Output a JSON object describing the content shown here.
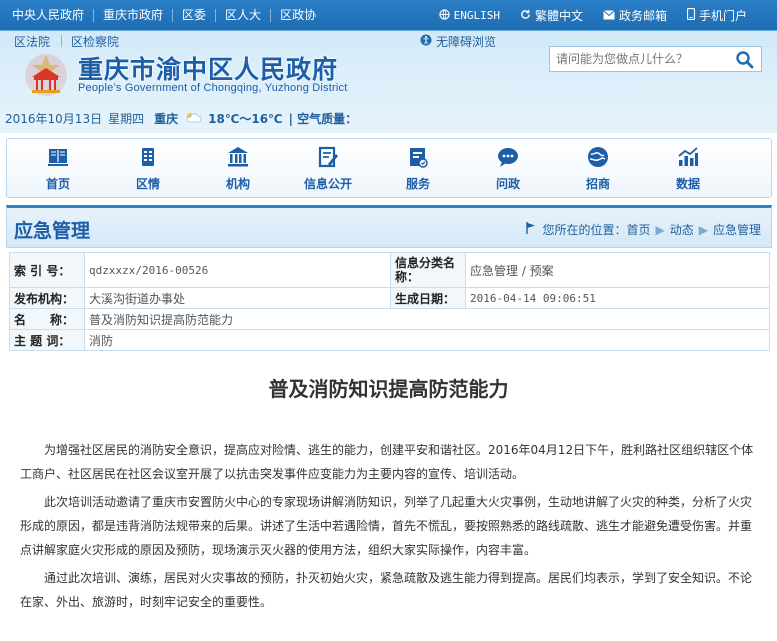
{
  "topbar": {
    "links": [
      "中央人民政府",
      "重庆市政府",
      "区委",
      "区人大",
      "区政协"
    ],
    "tools": [
      {
        "icon": "globe-icon",
        "label": "ENGLISH"
      },
      {
        "icon": "refresh-icon",
        "label": "繁體中文"
      },
      {
        "icon": "mail-icon",
        "label": "政务邮箱"
      },
      {
        "icon": "phone-icon",
        "label": "手机门户"
      }
    ]
  },
  "secondrow": {
    "links": [
      "区法院",
      "区检察院"
    ],
    "accessibility": "无障碍浏览"
  },
  "site": {
    "title": "重庆市渝中区人民政府",
    "subtitle": "People’s Government of Chongqing, Yuzhong District"
  },
  "search": {
    "placeholder": "请问能为您做点儿什么？"
  },
  "weather": {
    "date": "2016年10月13日",
    "weekday": "星期四",
    "city": "重庆",
    "temp": "18℃～16℃",
    "air": "| 空气质量："
  },
  "nav": {
    "items": [
      {
        "icon": "home-icon",
        "label": "首页"
      },
      {
        "icon": "district-icon",
        "label": "区情"
      },
      {
        "icon": "institution-icon",
        "label": "机构"
      },
      {
        "icon": "document-icon",
        "label": "信息公开"
      },
      {
        "icon": "service-icon",
        "label": "服务"
      },
      {
        "icon": "chat-icon",
        "label": "问政"
      },
      {
        "icon": "invest-icon",
        "label": "招商"
      },
      {
        "icon": "data-icon",
        "label": "数据"
      }
    ]
  },
  "section": {
    "title": "应急管理",
    "breadcrumb_prefix": "您所在的位置：",
    "breadcrumb": [
      "首页",
      "动态",
      "应急管理"
    ]
  },
  "info": {
    "index_key": "索 引 号：",
    "index_val": "qdzxxzx/2016-00526",
    "category_key": "信息分类名称：",
    "category_val": "应急管理 / 预案",
    "org_key": "发布机构：",
    "org_val": "大溪沟街道办事处",
    "date_key": "生成日期：",
    "date_val": "2016-04-14 09:06:51",
    "name_key": "名　　称：",
    "name_val": "普及消防知识提高防范能力",
    "topic_key": "主 题 词：",
    "topic_val": "消防"
  },
  "article": {
    "title": "普及消防知识提高防范能力",
    "paragraphs": [
      "为增强社区居民的消防安全意识，提高应对险情、逃生的能力，创建平安和谐社区。2016年04月12日下午，胜利路社区组织辖区个体工商户、社区居民在社区会议室开展了以抗击突发事件应变能力为主要内容的宣传、培训活动。",
      "此次培训活动邀请了重庆市安置防火中心的专家现场讲解消防知识，列举了几起重大火灾事例，生动地讲解了火灾的种类，分析了火灾形成的原因，都是违背消防法规带来的后果。讲述了生活中若遇险情，首先不慌乱，要按照熟悉的路线疏散、逃生才能避免遭受伤害。并重点讲解家庭火灾形成的原因及预防，现场演示灭火器的使用方法，组织大家实际操作，内容丰富。",
      "通过此次培训、演练，居民对火灾事故的预防，扑灭初始火灾，紧急疏散及逃生能力得到提高。居民们均表示，学到了安全知识。不论在家、外出、旅游时，时刻牢记安全的重要性。"
    ]
  },
  "colors": {
    "topbar": "#1f6db3",
    "brand": "#1d5ea8",
    "section_border": "#2f84c9"
  }
}
